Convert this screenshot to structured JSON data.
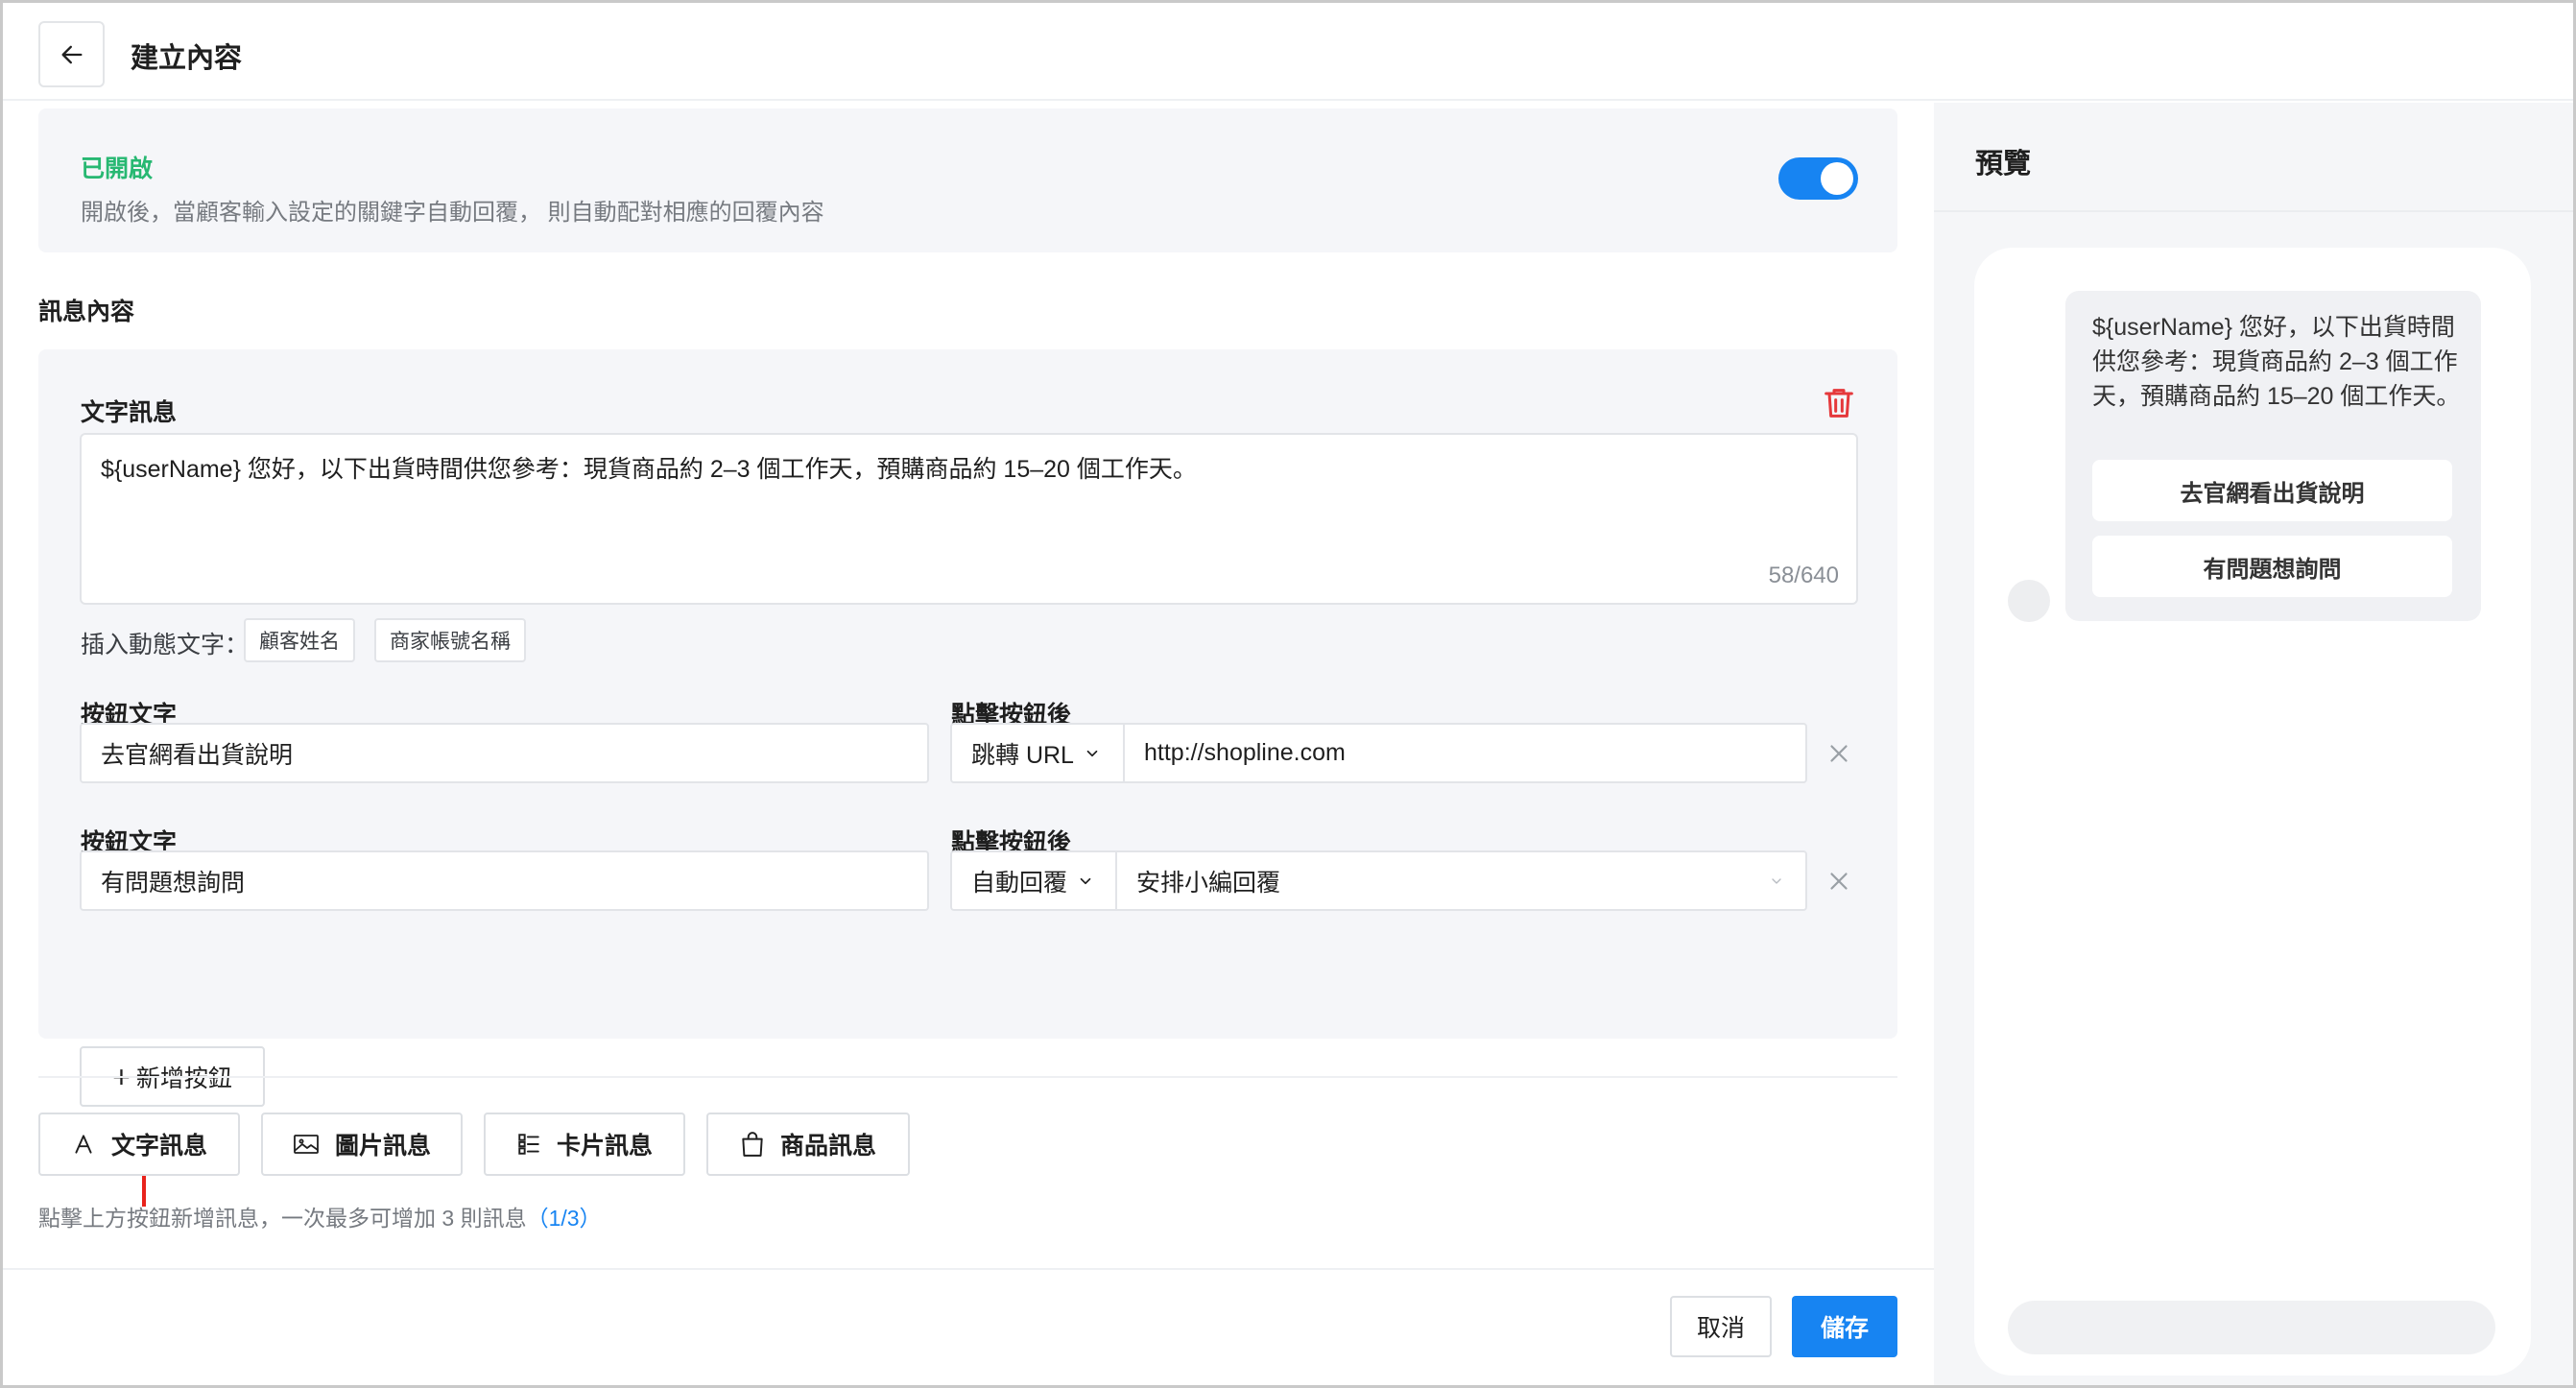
{
  "header": {
    "title": "建立內容"
  },
  "auto_reply": {
    "status_label": "已開啟",
    "description": "開啟後，當顧客輸入設定的關鍵字自動回覆， 則自動配對相應的回覆內容",
    "enabled": true
  },
  "message_section": {
    "title": "訊息內容"
  },
  "text_message": {
    "title": "文字訊息",
    "content": "${userName} 您好，以下出貨時間供您參考：現貨商品約 2–3 個工作天，預購商品約 15–20 個工作天。",
    "counter": "58/640",
    "insert_label": "插入動態文字：",
    "insert_chips": [
      "顧客姓名",
      "商家帳號名稱"
    ]
  },
  "buttons": [
    {
      "text_label": "按鈕文字",
      "text_value": "去官網看出貨說明",
      "action_label": "點擊按鈕後",
      "action_type": "跳轉 URL",
      "action_value": "http://shopline.com"
    },
    {
      "text_label": "按鈕文字",
      "text_value": "有問題想詢問",
      "action_label": "點擊按鈕後",
      "action_type": "自動回覆",
      "action_value": "安排小編回覆"
    }
  ],
  "add_button_label": "新增按鈕",
  "message_types": [
    {
      "label": "文字訊息",
      "icon": "text-icon"
    },
    {
      "label": "圖片訊息",
      "icon": "image-icon"
    },
    {
      "label": "卡片訊息",
      "icon": "card-list-icon"
    },
    {
      "label": "商品訊息",
      "icon": "shopping-bag-icon"
    }
  ],
  "hint": {
    "text": "點擊上方按鈕新增訊息，一次最多可增加 3 則訊息",
    "count": "（1/3）"
  },
  "footer": {
    "cancel": "取消",
    "save": "儲存"
  },
  "preview": {
    "title": "預覽",
    "bubble_text": "${userName} 您好，以下出貨時間供您參考：現貨商品約 2–3 個工作天，預購商品約 15–20 個工作天。",
    "buttons": [
      "去官網看出貨說明",
      "有問題想詢問"
    ]
  },
  "colors": {
    "accent": "#1784f2",
    "enabled_green": "#27b872",
    "danger_red": "#e5383b",
    "annotation_red": "#e8231c"
  }
}
